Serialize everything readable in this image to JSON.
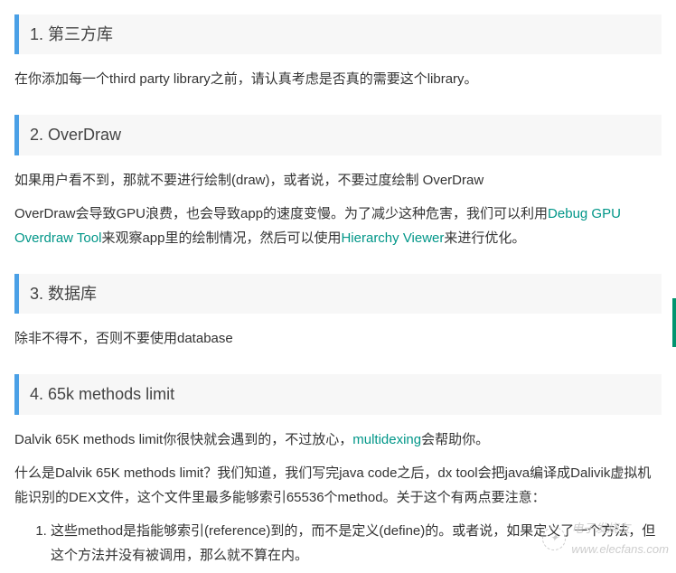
{
  "sections": [
    {
      "num": "1.",
      "title": "第三方库",
      "paragraphs": [
        {
          "parts": [
            {
              "t": "在你添加每一个third party library之前，请认真考虑是否真的需要这个library。"
            }
          ]
        }
      ]
    },
    {
      "num": "2.",
      "title": "OverDraw",
      "paragraphs": [
        {
          "parts": [
            {
              "t": "如果用户看不到，那就不要进行绘制(draw)，或者说，不要过度绘制 OverDraw"
            }
          ]
        },
        {
          "parts": [
            {
              "t": "OverDraw会导致GPU浪费，也会导致app的速度变慢。为了减少这种危害，我们可以利用"
            },
            {
              "t": "Debug GPU Overdraw Tool",
              "link": true
            },
            {
              "t": "来观察app里的绘制情况，然后可以使用"
            },
            {
              "t": "Hierarchy Viewer",
              "link": true
            },
            {
              "t": "来进行优化。"
            }
          ]
        }
      ]
    },
    {
      "num": "3.",
      "title": "数据库",
      "paragraphs": [
        {
          "parts": [
            {
              "t": "除非不得不，否则不要使用database"
            }
          ]
        }
      ]
    },
    {
      "num": "4.",
      "title": "65k methods limit",
      "paragraphs": [
        {
          "parts": [
            {
              "t": "Dalvik 65K methods limit你很快就会遇到的，不过放心，"
            },
            {
              "t": "multidexing",
              "link": true
            },
            {
              "t": "会帮助你。"
            }
          ]
        },
        {
          "parts": [
            {
              "t": "什么是Dalvik 65K methods limit？我们知道，我们写完java code之后，dx tool会把java编译成Dalivik虚拟机能识别的DEX文件，这个文件里最多能够索引65536个method。关于这个有两点要注意："
            }
          ]
        }
      ],
      "olist": [
        "这些method是指能够索引(reference)到的，而不是定义(define)的。或者说，如果定义了一个方法，但这个方法并没有被调用，那么就不算在内。"
      ]
    }
  ],
  "watermark": {
    "text": "电子发烧友",
    "url": "www.elecfans.com"
  }
}
